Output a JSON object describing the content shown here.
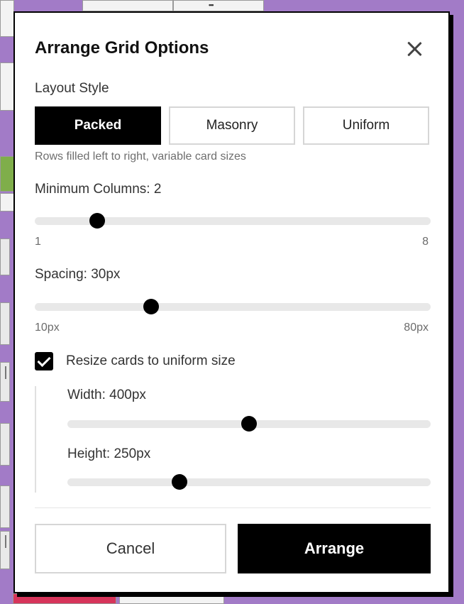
{
  "modal": {
    "title": "Arrange Grid Options",
    "layout_style": {
      "label": "Layout Style",
      "options": [
        "Packed",
        "Masonry",
        "Uniform"
      ],
      "selected": "Packed",
      "hint": "Rows filled left to right, variable card sizes"
    },
    "min_columns": {
      "label": "Minimum Columns: 2",
      "value": 2,
      "min": 1,
      "max": 8,
      "min_label": "1",
      "max_label": "8"
    },
    "spacing": {
      "label": "Spacing: 30px",
      "value": 30,
      "min": 10,
      "max": 80,
      "min_label": "10px",
      "max_label": "80px"
    },
    "resize": {
      "checked": true,
      "label": "Resize cards to uniform size",
      "width": {
        "label": "Width: 400px",
        "value": 400,
        "min": 100,
        "max": 700
      },
      "height": {
        "label": "Height: 250px",
        "value": 250,
        "min": 100,
        "max": 600
      }
    },
    "cancel_label": "Cancel",
    "arrange_label": "Arrange"
  },
  "icons": {
    "close": "close-icon",
    "check": "check-icon"
  },
  "colors": {
    "backdrop": "#a27bc7",
    "accent": "#000000",
    "track": "#e8e8e8"
  }
}
